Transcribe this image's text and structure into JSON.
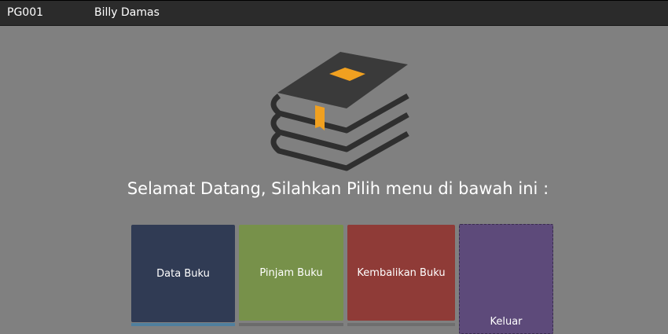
{
  "header": {
    "user_code": "PG001",
    "user_name": "Billy Damas"
  },
  "welcome_text": "Selamat Datang, Silahkan Pilih menu di bawah ini :",
  "menu": {
    "data_buku": "Data Buku",
    "pinjam_buku": "Pinjam Buku",
    "kembalikan_buku": "Kembalikan Buku",
    "keluar": "Keluar"
  },
  "colors": {
    "background": "#808080",
    "topbar": "#2b2b2b",
    "data_buku": "#303b54",
    "pinjam_buku": "#77914a",
    "kembalikan_buku": "#8f3b37",
    "keluar": "#5d4a7a",
    "book_accent": "#f0a020"
  },
  "icons": {
    "logo": "books-stack-icon"
  }
}
